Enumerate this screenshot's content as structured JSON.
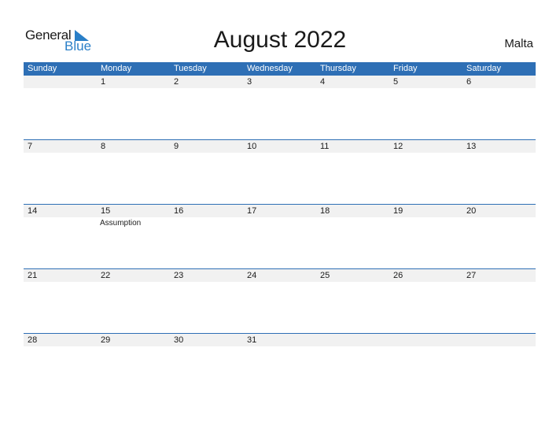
{
  "logo": {
    "general": "General",
    "blue": "Blue"
  },
  "title": "August 2022",
  "country": "Malta",
  "weekdays": [
    "Sunday",
    "Monday",
    "Tuesday",
    "Wednesday",
    "Thursday",
    "Friday",
    "Saturday"
  ],
  "weeks": [
    [
      "",
      "1",
      "2",
      "3",
      "4",
      "5",
      "6"
    ],
    [
      "7",
      "8",
      "9",
      "10",
      "11",
      "12",
      "13"
    ],
    [
      "14",
      "15",
      "16",
      "17",
      "18",
      "19",
      "20"
    ],
    [
      "21",
      "22",
      "23",
      "24",
      "25",
      "26",
      "27"
    ],
    [
      "28",
      "29",
      "30",
      "31",
      "",
      "",
      ""
    ]
  ],
  "holidays": [
    {
      "date": "15",
      "name": "Assumption"
    }
  ],
  "colors": {
    "header": "#2e6fb5",
    "strip": "#f1f1f1",
    "brand_blue": "#2a7fc8"
  }
}
